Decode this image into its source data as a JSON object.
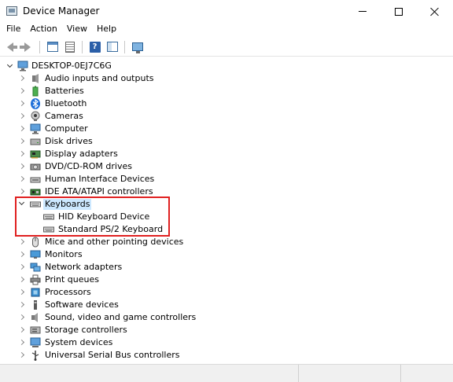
{
  "window": {
    "title": "Device Manager",
    "icon": "device-manager-icon"
  },
  "menu": [
    "File",
    "Action",
    "View",
    "Help"
  ],
  "toolbar": {
    "buttons": [
      "back-arrow-icon",
      "forward-arrow-icon",
      "properties-icon",
      "list-view-icon",
      "help-icon",
      "panel-view-icon",
      "monitor-icon"
    ]
  },
  "tree": {
    "root": "DESKTOP-0EJ7C6G",
    "categories": [
      {
        "label": "Audio inputs and outputs",
        "icon": "speaker-icon"
      },
      {
        "label": "Batteries",
        "icon": "battery-icon"
      },
      {
        "label": "Bluetooth",
        "icon": "bluetooth-icon"
      },
      {
        "label": "Cameras",
        "icon": "camera-icon"
      },
      {
        "label": "Computer",
        "icon": "computer-icon"
      },
      {
        "label": "Disk drives",
        "icon": "disk-drive-icon"
      },
      {
        "label": "Display adapters",
        "icon": "display-adapter-icon"
      },
      {
        "label": "DVD/CD-ROM drives",
        "icon": "dvd-drive-icon"
      },
      {
        "label": "Human Interface Devices",
        "icon": "hid-icon"
      },
      {
        "label": "IDE ATA/ATAPI controllers",
        "icon": "ide-controller-icon"
      },
      {
        "label": "Keyboards",
        "icon": "keyboard-icon",
        "expanded": true,
        "selected": true,
        "children": [
          {
            "label": "HID Keyboard Device",
            "icon": "keyboard-icon"
          },
          {
            "label": "Standard PS/2 Keyboard",
            "icon": "keyboard-icon"
          }
        ]
      },
      {
        "label": "Mice and other pointing devices",
        "icon": "mouse-icon"
      },
      {
        "label": "Monitors",
        "icon": "monitor-icon"
      },
      {
        "label": "Network adapters",
        "icon": "network-adapter-icon"
      },
      {
        "label": "Print queues",
        "icon": "printer-icon"
      },
      {
        "label": "Processors",
        "icon": "processor-icon"
      },
      {
        "label": "Software devices",
        "icon": "software-device-icon"
      },
      {
        "label": "Sound, video and game controllers",
        "icon": "sound-controller-icon"
      },
      {
        "label": "Storage controllers",
        "icon": "storage-controller-icon"
      },
      {
        "label": "System devices",
        "icon": "system-device-icon"
      },
      {
        "label": "Universal Serial Bus controllers",
        "icon": "usb-icon"
      }
    ]
  },
  "colors": {
    "selection": "#cce8ff",
    "highlight_box": "#e02020",
    "accent_blue": "#2b5fa8"
  }
}
